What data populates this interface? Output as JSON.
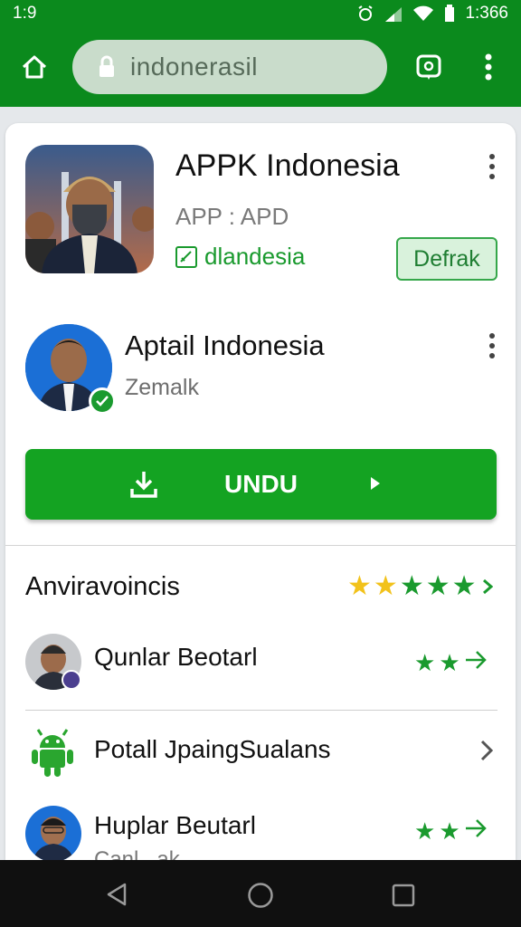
{
  "status_bar": {
    "time_left": "1:9",
    "time_right": "1:366"
  },
  "toolbar": {
    "url": "indonerasil"
  },
  "app": {
    "title": "APPK Indonesia",
    "subtitle": "APP : APD",
    "developer": "dlandesia",
    "detail_button": "Defrak"
  },
  "publisher": {
    "name": "Aptail Indonesia",
    "subtitle": "Zemalk"
  },
  "download": {
    "label": "UNDU"
  },
  "reviews": {
    "title": "Anviravoincis"
  },
  "rows": [
    {
      "name": "Qunlar Beotarl"
    },
    {
      "name": "Potall JpaingSualans"
    },
    {
      "name": "Huplar Beutarl",
      "sub": "Canl...ak"
    }
  ],
  "colors": {
    "brand": "#0b8a1d",
    "accent": "#14a322",
    "star_yellow": "#f2c21b"
  }
}
